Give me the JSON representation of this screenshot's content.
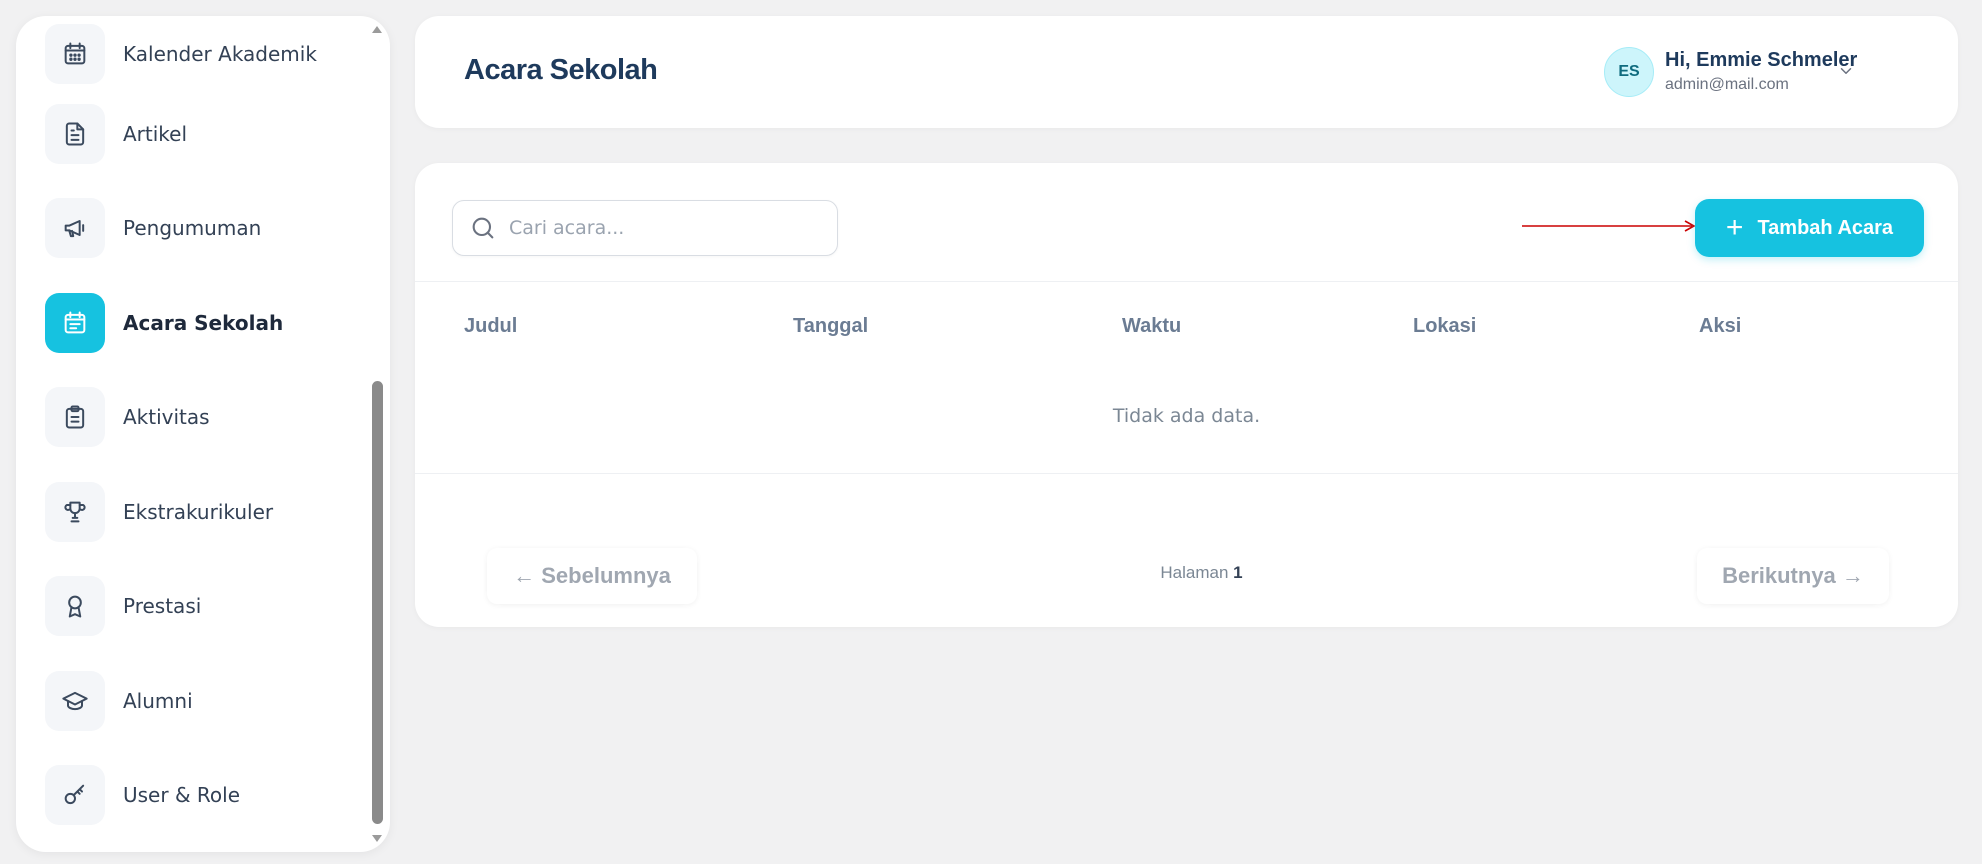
{
  "sidebar": {
    "items": [
      {
        "label": "Kalender Akademik",
        "icon": "calendar-icon"
      },
      {
        "label": "Artikel",
        "icon": "document-icon"
      },
      {
        "label": "Pengumuman",
        "icon": "megaphone-icon"
      },
      {
        "label": "Acara Sekolah",
        "icon": "calendar-event-icon",
        "active": true
      },
      {
        "label": "Aktivitas",
        "icon": "clipboard-icon"
      },
      {
        "label": "Ekstrakurikuler",
        "icon": "trophy-icon"
      },
      {
        "label": "Prestasi",
        "icon": "award-icon"
      },
      {
        "label": "Alumni",
        "icon": "graduation-cap-icon"
      },
      {
        "label": "User & Role",
        "icon": "key-icon"
      }
    ]
  },
  "header": {
    "title": "Acara Sekolah",
    "user": {
      "initials": "ES",
      "greeting": "Hi, Emmie Schmeler",
      "email": "admin@mail.com"
    }
  },
  "main": {
    "search": {
      "placeholder": "Cari acara..."
    },
    "add_button": {
      "label": "Tambah Acara"
    },
    "table": {
      "columns": [
        "Judul",
        "Tanggal",
        "Waktu",
        "Lokasi",
        "Aksi"
      ],
      "rows": [],
      "empty_text": "Tidak ada data."
    },
    "pagination": {
      "prev_label": "← Sebelumnya",
      "next_label": "Berikutnya →",
      "page_prefix": "Halaman",
      "current_page": "1"
    }
  },
  "colors": {
    "accent": "#16c2e0",
    "background": "#f1f1f2",
    "annotation_arrow": "#cc0000"
  }
}
